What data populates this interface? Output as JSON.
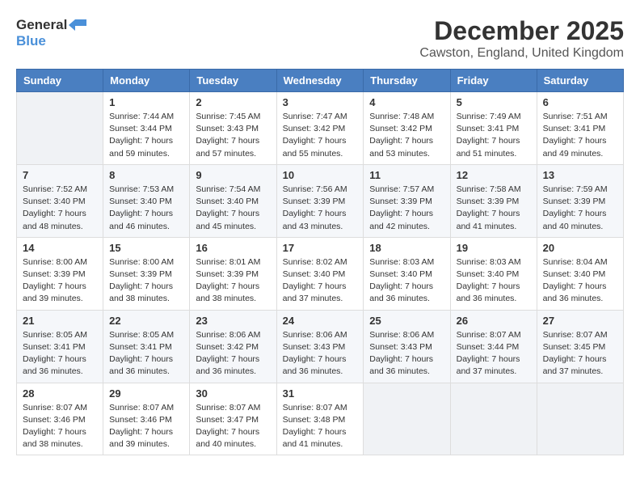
{
  "logo": {
    "general": "General",
    "blue": "Blue"
  },
  "title": "December 2025",
  "location": "Cawston, England, United Kingdom",
  "weekdays": [
    "Sunday",
    "Monday",
    "Tuesday",
    "Wednesday",
    "Thursday",
    "Friday",
    "Saturday"
  ],
  "weeks": [
    [
      {
        "empty": true
      },
      {
        "day": "1",
        "sunrise": "7:44 AM",
        "sunset": "3:44 PM",
        "daylight": "7 hours and 59 minutes."
      },
      {
        "day": "2",
        "sunrise": "7:45 AM",
        "sunset": "3:43 PM",
        "daylight": "7 hours and 57 minutes."
      },
      {
        "day": "3",
        "sunrise": "7:47 AM",
        "sunset": "3:42 PM",
        "daylight": "7 hours and 55 minutes."
      },
      {
        "day": "4",
        "sunrise": "7:48 AM",
        "sunset": "3:42 PM",
        "daylight": "7 hours and 53 minutes."
      },
      {
        "day": "5",
        "sunrise": "7:49 AM",
        "sunset": "3:41 PM",
        "daylight": "7 hours and 51 minutes."
      },
      {
        "day": "6",
        "sunrise": "7:51 AM",
        "sunset": "3:41 PM",
        "daylight": "7 hours and 49 minutes."
      }
    ],
    [
      {
        "day": "7",
        "sunrise": "7:52 AM",
        "sunset": "3:40 PM",
        "daylight": "7 hours and 48 minutes."
      },
      {
        "day": "8",
        "sunrise": "7:53 AM",
        "sunset": "3:40 PM",
        "daylight": "7 hours and 46 minutes."
      },
      {
        "day": "9",
        "sunrise": "7:54 AM",
        "sunset": "3:40 PM",
        "daylight": "7 hours and 45 minutes."
      },
      {
        "day": "10",
        "sunrise": "7:56 AM",
        "sunset": "3:39 PM",
        "daylight": "7 hours and 43 minutes."
      },
      {
        "day": "11",
        "sunrise": "7:57 AM",
        "sunset": "3:39 PM",
        "daylight": "7 hours and 42 minutes."
      },
      {
        "day": "12",
        "sunrise": "7:58 AM",
        "sunset": "3:39 PM",
        "daylight": "7 hours and 41 minutes."
      },
      {
        "day": "13",
        "sunrise": "7:59 AM",
        "sunset": "3:39 PM",
        "daylight": "7 hours and 40 minutes."
      }
    ],
    [
      {
        "day": "14",
        "sunrise": "8:00 AM",
        "sunset": "3:39 PM",
        "daylight": "7 hours and 39 minutes."
      },
      {
        "day": "15",
        "sunrise": "8:00 AM",
        "sunset": "3:39 PM",
        "daylight": "7 hours and 38 minutes."
      },
      {
        "day": "16",
        "sunrise": "8:01 AM",
        "sunset": "3:39 PM",
        "daylight": "7 hours and 38 minutes."
      },
      {
        "day": "17",
        "sunrise": "8:02 AM",
        "sunset": "3:40 PM",
        "daylight": "7 hours and 37 minutes."
      },
      {
        "day": "18",
        "sunrise": "8:03 AM",
        "sunset": "3:40 PM",
        "daylight": "7 hours and 36 minutes."
      },
      {
        "day": "19",
        "sunrise": "8:03 AM",
        "sunset": "3:40 PM",
        "daylight": "7 hours and 36 minutes."
      },
      {
        "day": "20",
        "sunrise": "8:04 AM",
        "sunset": "3:40 PM",
        "daylight": "7 hours and 36 minutes."
      }
    ],
    [
      {
        "day": "21",
        "sunrise": "8:05 AM",
        "sunset": "3:41 PM",
        "daylight": "7 hours and 36 minutes."
      },
      {
        "day": "22",
        "sunrise": "8:05 AM",
        "sunset": "3:41 PM",
        "daylight": "7 hours and 36 minutes."
      },
      {
        "day": "23",
        "sunrise": "8:06 AM",
        "sunset": "3:42 PM",
        "daylight": "7 hours and 36 minutes."
      },
      {
        "day": "24",
        "sunrise": "8:06 AM",
        "sunset": "3:43 PM",
        "daylight": "7 hours and 36 minutes."
      },
      {
        "day": "25",
        "sunrise": "8:06 AM",
        "sunset": "3:43 PM",
        "daylight": "7 hours and 36 minutes."
      },
      {
        "day": "26",
        "sunrise": "8:07 AM",
        "sunset": "3:44 PM",
        "daylight": "7 hours and 37 minutes."
      },
      {
        "day": "27",
        "sunrise": "8:07 AM",
        "sunset": "3:45 PM",
        "daylight": "7 hours and 37 minutes."
      }
    ],
    [
      {
        "day": "28",
        "sunrise": "8:07 AM",
        "sunset": "3:46 PM",
        "daylight": "7 hours and 38 minutes."
      },
      {
        "day": "29",
        "sunrise": "8:07 AM",
        "sunset": "3:46 PM",
        "daylight": "7 hours and 39 minutes."
      },
      {
        "day": "30",
        "sunrise": "8:07 AM",
        "sunset": "3:47 PM",
        "daylight": "7 hours and 40 minutes."
      },
      {
        "day": "31",
        "sunrise": "8:07 AM",
        "sunset": "3:48 PM",
        "daylight": "7 hours and 41 minutes."
      },
      {
        "empty": true
      },
      {
        "empty": true
      },
      {
        "empty": true
      }
    ]
  ]
}
